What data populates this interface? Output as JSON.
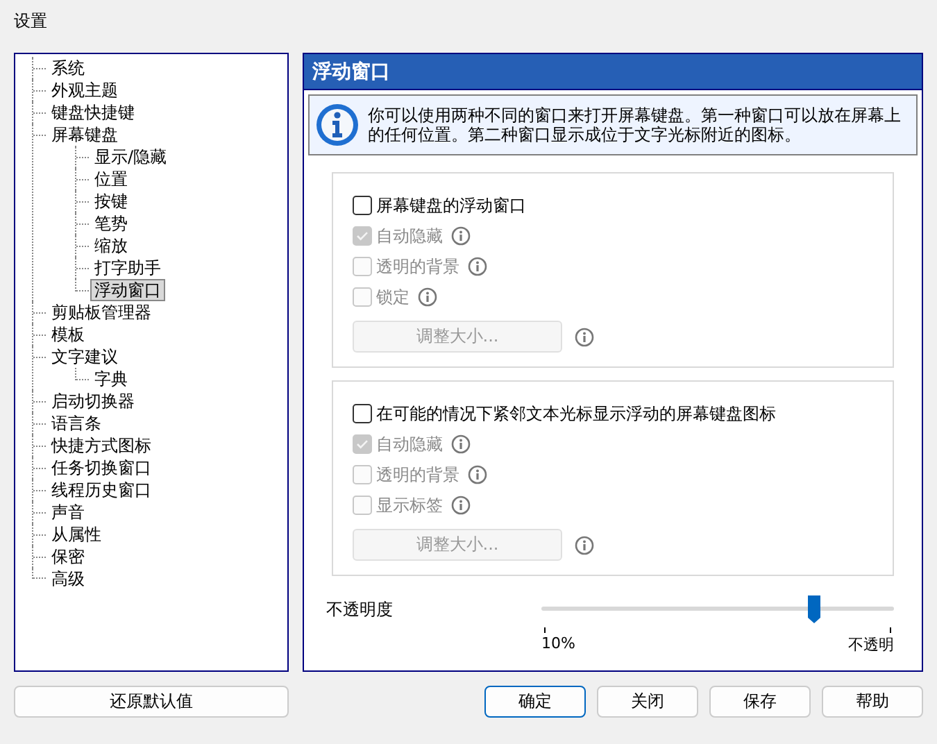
{
  "window": {
    "title": "设置"
  },
  "tree": [
    {
      "label": "系统",
      "selected": false
    },
    {
      "label": "外观主题",
      "selected": false
    },
    {
      "label": "键盘快捷键",
      "selected": false
    },
    {
      "label": "屏幕键盘",
      "selected": false,
      "children": [
        {
          "label": "显示/隐藏",
          "selected": false
        },
        {
          "label": "位置",
          "selected": false
        },
        {
          "label": "按键",
          "selected": false
        },
        {
          "label": "笔势",
          "selected": false
        },
        {
          "label": "缩放",
          "selected": false
        },
        {
          "label": "打字助手",
          "selected": false
        },
        {
          "label": "浮动窗口",
          "selected": true
        }
      ]
    },
    {
      "label": "剪贴板管理器",
      "selected": false
    },
    {
      "label": "模板",
      "selected": false
    },
    {
      "label": "文字建议",
      "selected": false,
      "children": [
        {
          "label": "字典",
          "selected": false
        }
      ]
    },
    {
      "label": "启动切换器",
      "selected": false
    },
    {
      "label": "语言条",
      "selected": false
    },
    {
      "label": "快捷方式图标",
      "selected": false
    },
    {
      "label": "任务切换窗口",
      "selected": false
    },
    {
      "label": "线程历史窗口",
      "selected": false
    },
    {
      "label": "声音",
      "selected": false
    },
    {
      "label": "从属性",
      "selected": false
    },
    {
      "label": "保密",
      "selected": false
    },
    {
      "label": "高级",
      "selected": false
    }
  ],
  "panel": {
    "title": "浮动窗口",
    "info": "你可以使用两种不同的窗口来打开屏幕键盘。第一种窗口可以放在屏幕上的任何位置。第二种窗口显示成位于文字光标附近的图标。",
    "groups": [
      {
        "main": {
          "label": "屏幕键盘的浮动窗口",
          "checked": false
        },
        "options": [
          {
            "label": "自动隐藏",
            "checked": true,
            "disabled": true
          },
          {
            "label": "透明的背景",
            "checked": false,
            "disabled": true
          },
          {
            "label": "锁定",
            "checked": false,
            "disabled": true
          }
        ],
        "button": {
          "label": "调整大小...",
          "disabled": true
        }
      },
      {
        "main": {
          "label": "在可能的情况下紧邻文本光标显示浮动的屏幕键盘图标",
          "checked": false
        },
        "options": [
          {
            "label": "自动隐藏",
            "checked": true,
            "disabled": true
          },
          {
            "label": "透明的背景",
            "checked": false,
            "disabled": true
          },
          {
            "label": "显示标签",
            "checked": false,
            "disabled": true
          }
        ],
        "button": {
          "label": "调整大小...",
          "disabled": true
        }
      }
    ],
    "opacity": {
      "label": "不透明度",
      "level": 0.77,
      "min_label": "10%",
      "max_label": "不透明"
    }
  },
  "buttons": {
    "reset": "还原默认值",
    "actions": [
      {
        "label": "确定",
        "default": true
      },
      {
        "label": "关闭",
        "default": false
      },
      {
        "label": "保存",
        "default": false
      },
      {
        "label": "帮助",
        "default": false
      }
    ]
  }
}
